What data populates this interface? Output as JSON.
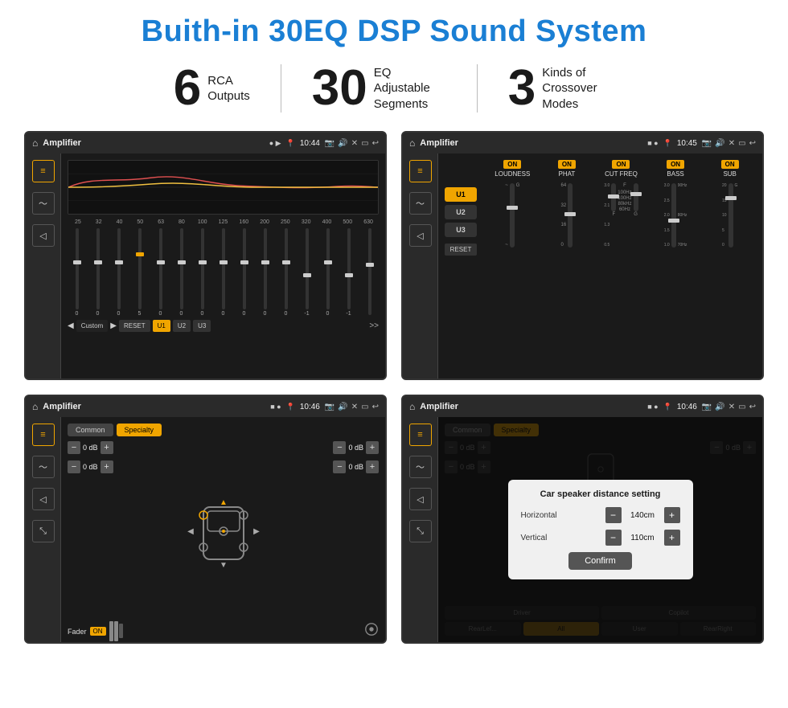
{
  "title": "Buith-in 30EQ DSP Sound System",
  "stats": [
    {
      "number": "6",
      "label": "RCA\nOutputs"
    },
    {
      "number": "30",
      "label": "EQ Adjustable\nSegments"
    },
    {
      "number": "3",
      "label": "Kinds of\nCrossover Modes"
    }
  ],
  "screens": [
    {
      "id": "screen1",
      "topbar": {
        "title": "Amplifier",
        "time": "10:44",
        "dots": "● ▶"
      },
      "type": "equalizer"
    },
    {
      "id": "screen2",
      "topbar": {
        "title": "Amplifier",
        "time": "10:45",
        "dots": "■ ●"
      },
      "type": "amplifier"
    },
    {
      "id": "screen3",
      "topbar": {
        "title": "Amplifier",
        "time": "10:46",
        "dots": "■ ●"
      },
      "type": "crossover"
    },
    {
      "id": "screen4",
      "topbar": {
        "title": "Amplifier",
        "time": "10:46",
        "dots": "■ ●"
      },
      "type": "crossover-dialog",
      "dialog": {
        "title": "Car speaker distance setting",
        "horizontal_label": "Horizontal",
        "horizontal_value": "140cm",
        "vertical_label": "Vertical",
        "vertical_value": "110cm",
        "confirm_label": "Confirm"
      }
    }
  ],
  "eq_freqs": [
    "25",
    "32",
    "40",
    "50",
    "63",
    "80",
    "100",
    "125",
    "160",
    "200",
    "250",
    "320",
    "400",
    "500",
    "630"
  ],
  "eq_values": [
    "0",
    "0",
    "0",
    "5",
    "0",
    "0",
    "0",
    "0",
    "0",
    "0",
    "0",
    "-1",
    "0",
    "-1",
    ""
  ],
  "eq_presets": [
    "Custom",
    "RESET",
    "U1",
    "U2",
    "U3"
  ],
  "amp_channels": [
    {
      "name": "LOUDNESS",
      "on": true
    },
    {
      "name": "PHAT",
      "on": true
    },
    {
      "name": "CUT FREQ",
      "on": true
    },
    {
      "name": "BASS",
      "on": true
    },
    {
      "name": "SUB",
      "on": true
    }
  ],
  "crossover_tabs": [
    "Common",
    "Specialty"
  ],
  "crossover_btns": [
    "Driver",
    "Copilot",
    "RearLeft",
    "All",
    "User",
    "RearRight"
  ],
  "vol_rows": [
    {
      "label": "0 dB"
    },
    {
      "label": "0 dB"
    },
    {
      "label": "0 dB"
    },
    {
      "label": "0 dB"
    }
  ],
  "fader_label": "Fader",
  "fader_on": "ON"
}
